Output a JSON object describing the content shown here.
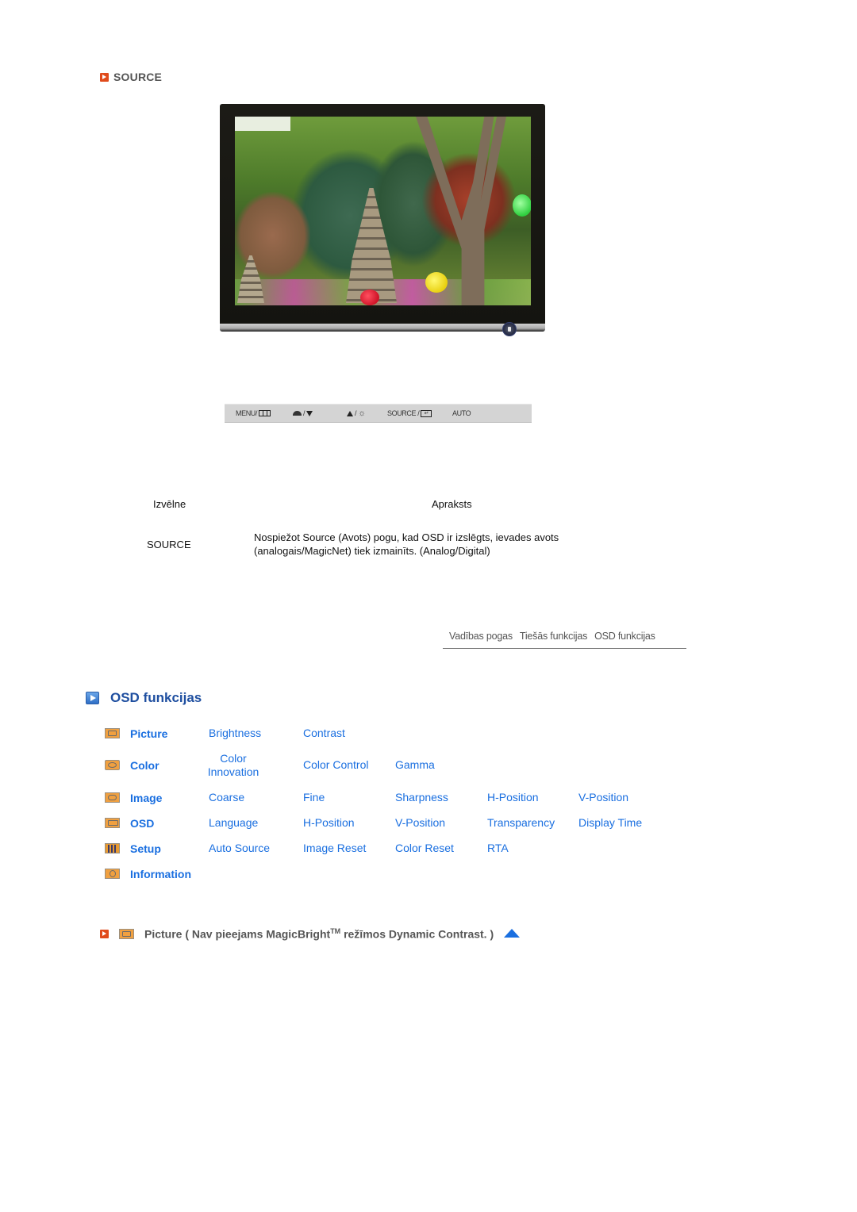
{
  "source_section": {
    "title": "SOURCE",
    "icon": "red-arrow-icon"
  },
  "monitor": {
    "image_alt": "Monitor displaying garden with stone pagoda and lanterns"
  },
  "button_bar": {
    "menu_label": "MENU/",
    "menu_icon": "menu-grid-icon",
    "magicbright_icon": "magicbright-icon",
    "down_icon": "triangle-down-icon",
    "up_icon": "triangle-up-icon",
    "brightness_icon": "brightness-sun-icon",
    "slash": "/",
    "source_label": "SOURCE /",
    "enter_icon": "enter-icon",
    "auto_label": "AUTO"
  },
  "table": {
    "headers": {
      "menu": "Izvēlne",
      "description": "Apraksts"
    },
    "rows": [
      {
        "menu": "SOURCE",
        "description_line1": "Nospiežot Source (Avots) pogu, kad OSD ir izslēgts, ievades avots",
        "description_line2": "(analogais/MagicNet) tiek izmainīts. (Analog/Digital)"
      }
    ]
  },
  "nav_links": [
    "Vadības pogas",
    "Tiešās funkcijas",
    "OSD funkcijas"
  ],
  "osd": {
    "title": "OSD funkcijas",
    "categories": [
      {
        "label": "Picture",
        "icon": "picture-icon",
        "items": [
          "Brightness",
          "Contrast"
        ]
      },
      {
        "label": "Color",
        "icon": "color-icon",
        "items": [
          "Color Innovation",
          "Color Control",
          "Gamma"
        ],
        "item0_line1": "Color",
        "item0_line2": "Innovation"
      },
      {
        "label": "Image",
        "icon": "image-icon",
        "items": [
          "Coarse",
          "Fine",
          "Sharpness",
          "H-Position",
          "V-Position"
        ]
      },
      {
        "label": "OSD",
        "icon": "osd-icon",
        "items": [
          "Language",
          "H-Position",
          "V-Position",
          "Transparency",
          "Display Time"
        ]
      },
      {
        "label": "Setup",
        "icon": "setup-icon",
        "items": [
          "Auto Source",
          "Image Reset",
          "Color Reset",
          "RTA"
        ]
      },
      {
        "label": "Information",
        "icon": "information-icon",
        "items": []
      }
    ]
  },
  "picture_section": {
    "title_pre": "Picture ( Nav pieejams MagicBright",
    "tm": "TM",
    "title_post": " režīmos Dynamic Contrast. )",
    "up_icon": "scroll-top-icon"
  },
  "colors": {
    "link_blue": "#1a6fe0",
    "heading_blue": "#1f4fa0",
    "accent_red": "#e04b1c",
    "icon_orange": "#f0a040"
  }
}
